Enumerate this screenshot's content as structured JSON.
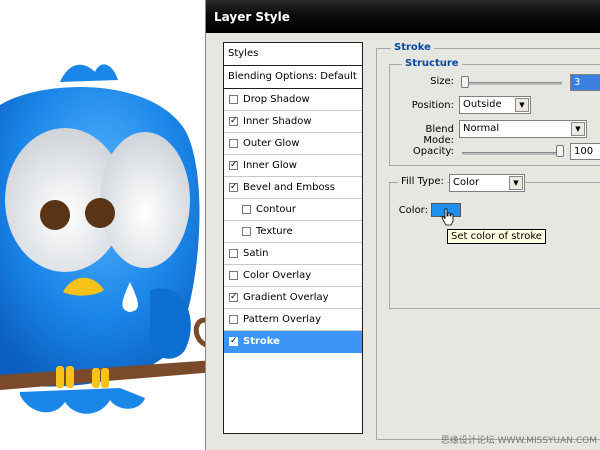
{
  "dialog": {
    "title": "Layer Style"
  },
  "styles_panel": {
    "header": "Styles",
    "blending_options": "Blending Options: Default",
    "items": [
      {
        "label": "Drop Shadow",
        "checked": false,
        "indent": false,
        "active": false
      },
      {
        "label": "Inner Shadow",
        "checked": true,
        "indent": false,
        "active": false
      },
      {
        "label": "Outer Glow",
        "checked": false,
        "indent": false,
        "active": false
      },
      {
        "label": "Inner Glow",
        "checked": true,
        "indent": false,
        "active": false
      },
      {
        "label": "Bevel and Emboss",
        "checked": true,
        "indent": false,
        "active": false
      },
      {
        "label": "Contour",
        "checked": false,
        "indent": true,
        "active": false
      },
      {
        "label": "Texture",
        "checked": false,
        "indent": true,
        "active": false
      },
      {
        "label": "Satin",
        "checked": false,
        "indent": false,
        "active": false
      },
      {
        "label": "Color Overlay",
        "checked": false,
        "indent": false,
        "active": false
      },
      {
        "label": "Gradient Overlay",
        "checked": true,
        "indent": false,
        "active": false
      },
      {
        "label": "Pattern Overlay",
        "checked": false,
        "indent": false,
        "active": false
      },
      {
        "label": "Stroke",
        "checked": true,
        "indent": false,
        "active": true
      }
    ]
  },
  "stroke": {
    "section_title": "Stroke",
    "structure_title": "Structure",
    "size_label": "Size:",
    "size_value": "3",
    "position_label": "Position:",
    "position_value": "Outside",
    "blend_mode_label": "Blend Mode:",
    "blend_mode_value": "Normal",
    "opacity_label": "Opacity:",
    "opacity_value": "100",
    "opacity_fraction": 1.0,
    "size_fraction": 0.03,
    "fill_type_label": "Fill Type:",
    "fill_type_value": "Color",
    "color_label": "Color:",
    "color_value": "#1f8ff0",
    "tooltip": "Set color of stroke"
  },
  "watermark": "思缘设计论坛 WWW.MISSYUAN.COM",
  "colors": {
    "accent": "#3d95f7",
    "bird_blue": "#1a86e8",
    "title_bar": "#000000"
  }
}
